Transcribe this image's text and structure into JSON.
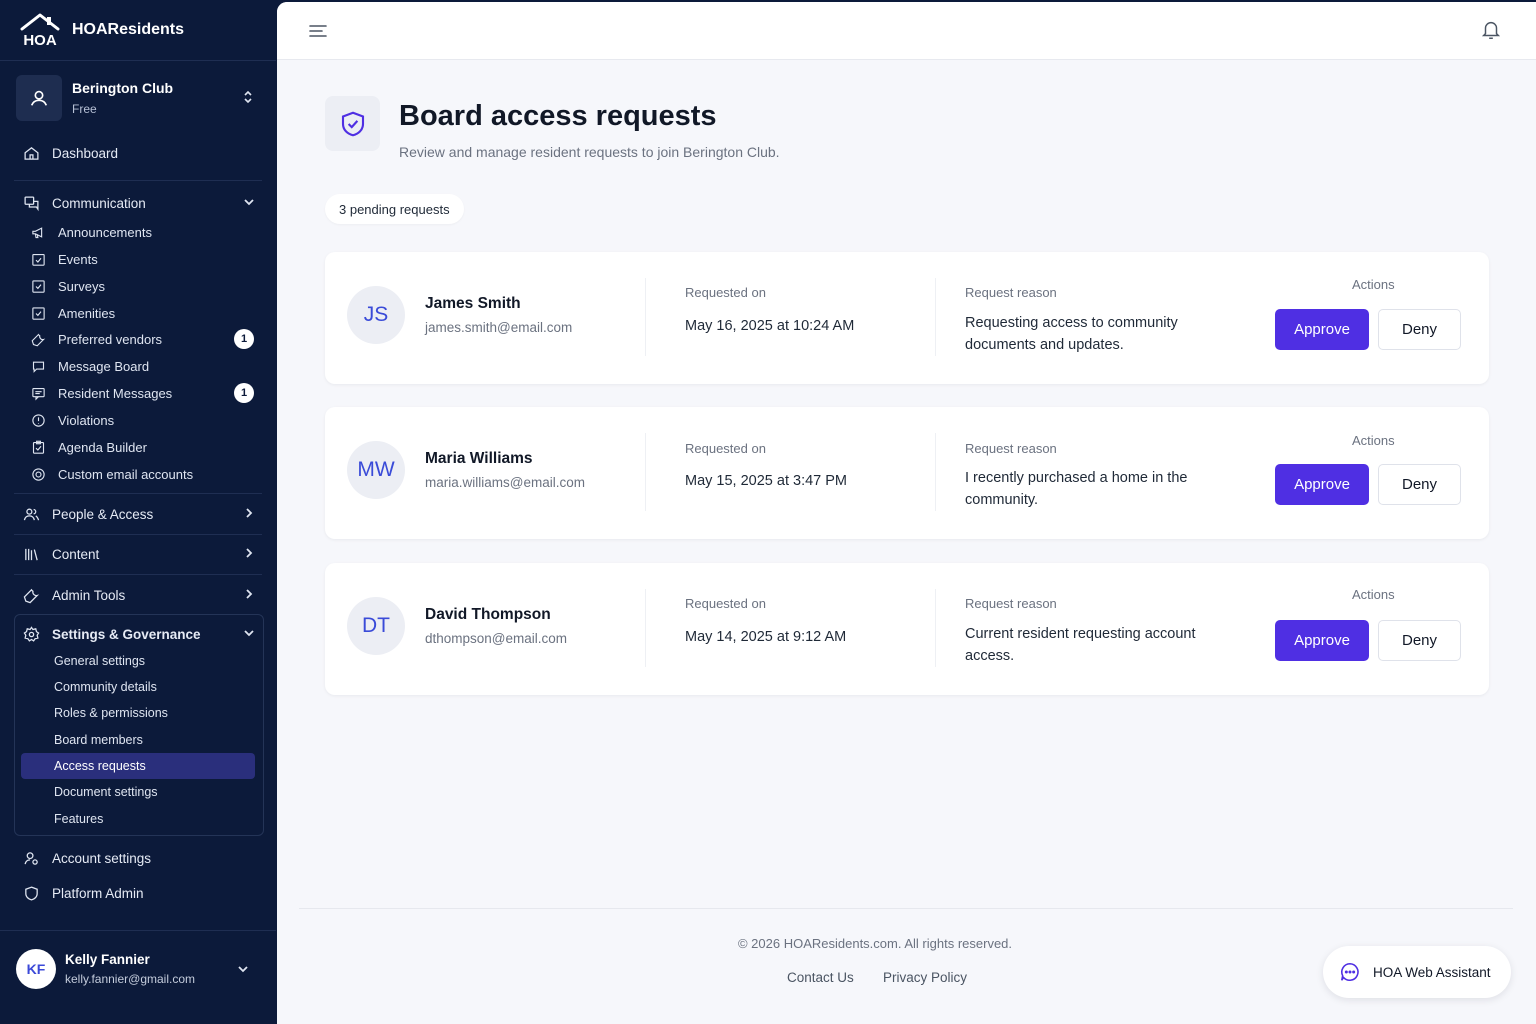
{
  "app": {
    "name": "HOAResidents"
  },
  "club": {
    "name": "Berington Club",
    "plan": "Free"
  },
  "nav": {
    "dashboard": "Dashboard",
    "communication": "Communication",
    "communication_items": [
      {
        "label": "Announcements",
        "icon": "megaphone-icon"
      },
      {
        "label": "Events",
        "icon": "calendar-check-icon"
      },
      {
        "label": "Surveys",
        "icon": "checkbox-icon"
      },
      {
        "label": "Amenities",
        "icon": "checkbox-icon"
      },
      {
        "label": "Preferred vendors",
        "icon": "wrench-icon",
        "badge": "1"
      },
      {
        "label": "Message Board",
        "icon": "chat-bubble-icon"
      },
      {
        "label": "Resident Messages",
        "icon": "message-square-icon",
        "badge": "1"
      },
      {
        "label": "Violations",
        "icon": "alert-circle-icon"
      },
      {
        "label": "Agenda Builder",
        "icon": "clipboard-icon"
      },
      {
        "label": "Custom email accounts",
        "icon": "at-sign-icon"
      }
    ],
    "people_access": "People & Access",
    "content": "Content",
    "admin_tools": "Admin Tools",
    "settings_governance": "Settings & Governance",
    "settings_items": [
      "General settings",
      "Community details",
      "Roles & permissions",
      "Board members",
      "Access requests",
      "Document settings",
      "Features"
    ],
    "account_settings": "Account settings",
    "platform_admin": "Platform Admin"
  },
  "user": {
    "initials": "KF",
    "name": "Kelly Fannier",
    "email": "kelly.fannier@gmail.com"
  },
  "page": {
    "title": "Board access requests",
    "subtitle": "Review and manage resident requests to join Berington Club.",
    "pending": "3 pending requests"
  },
  "labels": {
    "requested_on": "Requested on",
    "request_reason": "Request reason",
    "actions": "Actions",
    "approve": "Approve",
    "deny": "Deny"
  },
  "requests": [
    {
      "initials": "JS",
      "name": "James Smith",
      "email": "james.smith@email.com",
      "date": "May 16, 2025 at 10:24 AM",
      "reason": "Requesting access to community documents and updates."
    },
    {
      "initials": "MW",
      "name": "Maria Williams",
      "email": "maria.williams@email.com",
      "date": "May 15, 2025 at 3:47 PM",
      "reason": "I recently purchased a home in the community."
    },
    {
      "initials": "DT",
      "name": "David Thompson",
      "email": "dthompson@email.com",
      "date": "May 14, 2025 at 9:12 AM",
      "reason": "Current resident requesting account access."
    }
  ],
  "footer": {
    "copyright": "© 2026 HOAResidents.com. All rights reserved.",
    "contact": "Contact Us",
    "privacy": "Privacy Policy"
  },
  "assistant": {
    "label": "HOA Web Assistant"
  },
  "colors": {
    "sidebar_bg": "#0c1a3a",
    "primary": "#4f2fe3",
    "active_nav": "#2a2f7c",
    "avatar_text": "#3a4bd8"
  }
}
